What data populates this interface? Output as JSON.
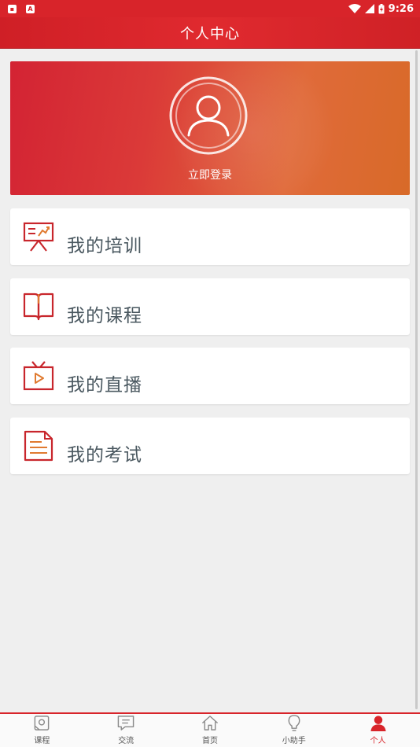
{
  "status_bar": {
    "time": "9:26",
    "icon_a_label": "A"
  },
  "header": {
    "title": "个人中心"
  },
  "profile": {
    "login_label": "立即登录",
    "avatar_icon": "user-avatar-icon"
  },
  "menu": [
    {
      "label": "我的培训",
      "icon": "presentation-board-icon"
    },
    {
      "label": "我的课程",
      "icon": "open-book-icon"
    },
    {
      "label": "我的直播",
      "icon": "tv-play-icon"
    },
    {
      "label": "我的考试",
      "icon": "document-icon"
    }
  ],
  "bottom_nav": [
    {
      "label": "课程",
      "icon": "course-icon",
      "active": false
    },
    {
      "label": "交流",
      "icon": "chat-icon",
      "active": false
    },
    {
      "label": "首页",
      "icon": "home-icon",
      "active": false
    },
    {
      "label": "小助手",
      "icon": "lightbulb-icon",
      "active": false
    },
    {
      "label": "个人",
      "icon": "person-icon",
      "active": true
    }
  ],
  "colors": {
    "brand_red": "#d8242a",
    "icon_orange": "#e07a30",
    "label_gray": "#4a5860"
  }
}
